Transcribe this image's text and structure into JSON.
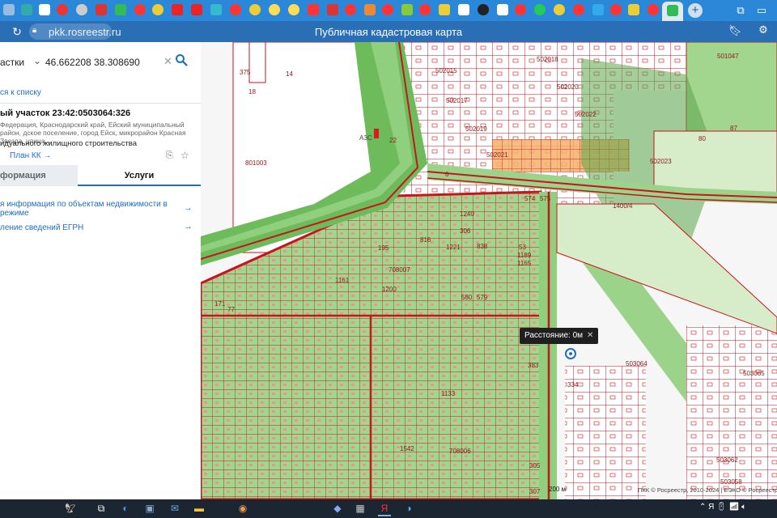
{
  "browser": {
    "url": "pkk.rosreestr.ru",
    "page_title": "Публичная кадастровая карта",
    "tab_count": 45
  },
  "sidebar": {
    "search_type": "астки",
    "search_value": "46.662208 38.308690",
    "back_link": "ся к списку",
    "parcel_title": "ый участок 23:42:0503064:326",
    "parcel_address": "Федерация, Краснодарский край, Ейский муниципальный район, дское поселение, город Ейск, микрорайон Красная Звезда, улица...",
    "parcel_use": "идуального жилищного строительства",
    "plan_link": "План КК →",
    "tabs": {
      "info": "формация",
      "services": "Услуги"
    },
    "services": [
      {
        "label": "я информация по объектам недвижимости в режиме"
      },
      {
        "label": "ление сведений ЕГРН"
      }
    ]
  },
  "map": {
    "distance_label": "Расстояние: 0м",
    "scale_label": "200 м",
    "copyright": "ПКК © Росреестр, 2010-2024 | ЕЭКО © Росреестр",
    "labels": [
      {
        "text": "501047"
      },
      {
        "text": "502018"
      },
      {
        "text": "502015"
      },
      {
        "text": "502020"
      },
      {
        "text": "502017"
      },
      {
        "text": "502022"
      },
      {
        "text": "502019"
      },
      {
        "text": "502021"
      },
      {
        "text": "502023"
      },
      {
        "text": "801003"
      },
      {
        "text": "708007"
      },
      {
        "text": "708006"
      },
      {
        "text": "503064"
      },
      {
        "text": "503065"
      },
      {
        "text": "503062"
      },
      {
        "text": "503058"
      },
      {
        "text": "1400/4"
      },
      {
        "text": "АЗС"
      },
      {
        "text": "14"
      },
      {
        "text": "18"
      },
      {
        "text": "375"
      },
      {
        "text": "1161"
      },
      {
        "text": "1200"
      },
      {
        "text": "1133"
      },
      {
        "text": "1542"
      },
      {
        "text": "838"
      },
      {
        "text": "1221"
      },
      {
        "text": "1189"
      },
      {
        "text": "1165"
      },
      {
        "text": "306"
      },
      {
        "text": "305"
      },
      {
        "text": "307"
      },
      {
        "text": "383"
      },
      {
        "text": "334"
      },
      {
        "text": "87"
      },
      {
        "text": "80"
      },
      {
        "text": "574"
      },
      {
        "text": "575"
      },
      {
        "text": "580"
      },
      {
        "text": "579"
      },
      {
        "text": "1240"
      },
      {
        "text": "816"
      },
      {
        "text": "195"
      },
      {
        "text": "53"
      },
      {
        "text": "22"
      },
      {
        "text": "6"
      },
      {
        "text": "171"
      },
      {
        "text": "77"
      }
    ]
  },
  "colors": {
    "parcel_border": "#c8141e",
    "green_zone": "#8fcf7e",
    "road_green": "#6dbb5a",
    "browser_blue": "#2b88d8",
    "accent": "#1e6dc4"
  }
}
